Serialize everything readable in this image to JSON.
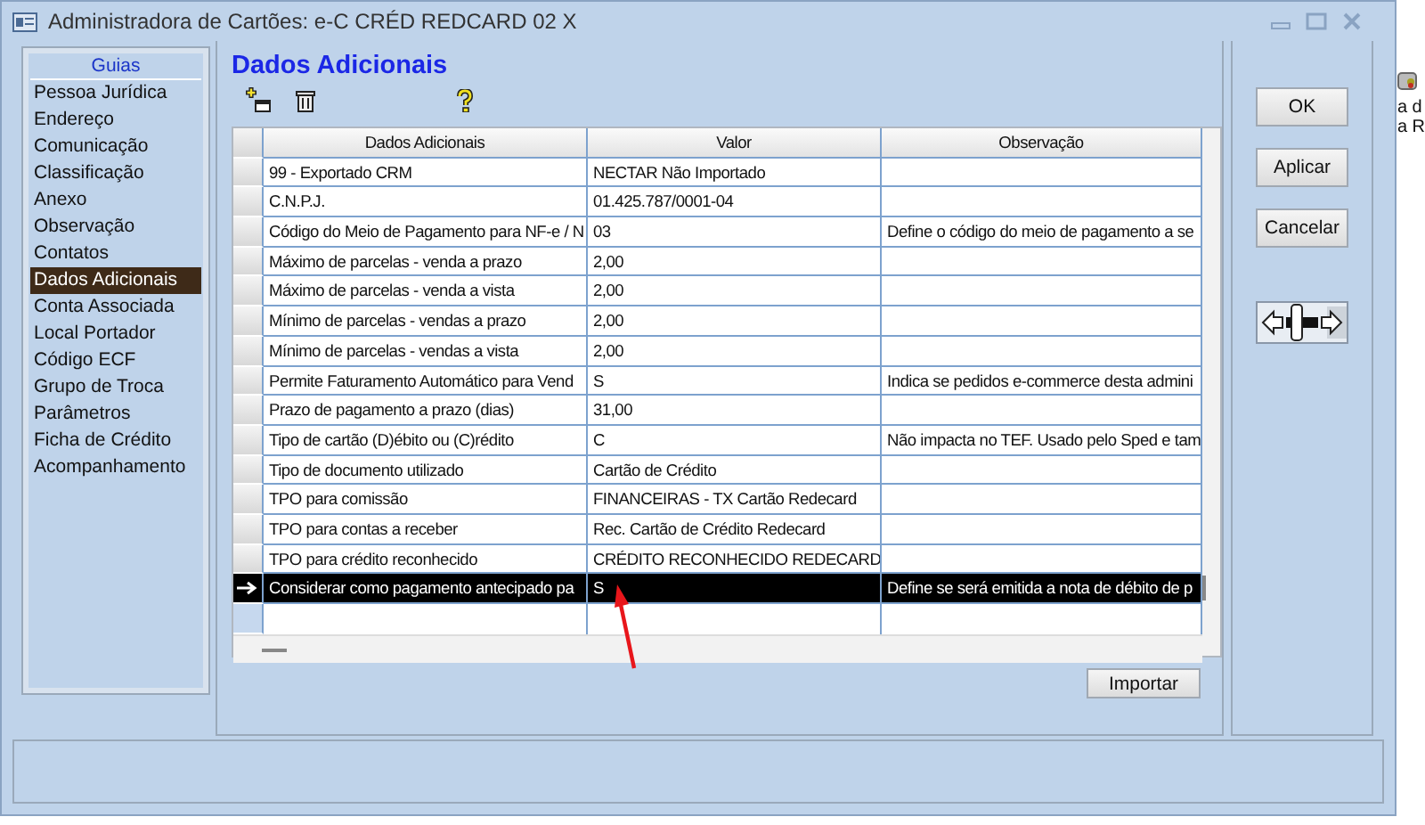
{
  "window": {
    "title": "Administradora de Cartões: e-C CRÉD REDCARD 02 X"
  },
  "sidebar": {
    "header": "Guias",
    "items": [
      {
        "label": "Pessoa Jurídica",
        "selected": false
      },
      {
        "label": "Endereço",
        "selected": false
      },
      {
        "label": "Comunicação",
        "selected": false
      },
      {
        "label": "Classificação",
        "selected": false
      },
      {
        "label": "Anexo",
        "selected": false
      },
      {
        "label": "Observação",
        "selected": false
      },
      {
        "label": "Contatos",
        "selected": false
      },
      {
        "label": "Dados Adicionais",
        "selected": true
      },
      {
        "label": "Conta Associada",
        "selected": false
      },
      {
        "label": "Local Portador",
        "selected": false
      },
      {
        "label": "Código ECF",
        "selected": false
      },
      {
        "label": "Grupo de Troca",
        "selected": false
      },
      {
        "label": "Parâmetros",
        "selected": false
      },
      {
        "label": "Ficha de Crédito",
        "selected": false
      },
      {
        "label": "Acompanhamento",
        "selected": false
      }
    ]
  },
  "panel": {
    "title": "Dados Adicionais"
  },
  "table": {
    "columns": [
      "Dados Adicionais",
      "Valor",
      "Observação"
    ],
    "rows": [
      {
        "cells": [
          "99 - Exportado CRM",
          "NECTAR Não Importado",
          ""
        ],
        "selected": false
      },
      {
        "cells": [
          "C.N.P.J.",
          "01.425.787/0001-04",
          ""
        ],
        "selected": false
      },
      {
        "cells": [
          "Código do Meio de Pagamento para NF-e / N",
          "03",
          "Define o código do meio de pagamento a se"
        ],
        "selected": false
      },
      {
        "cells": [
          "Máximo de parcelas - venda a prazo",
          "2,00",
          ""
        ],
        "selected": false
      },
      {
        "cells": [
          "Máximo de parcelas - venda a vista",
          "2,00",
          ""
        ],
        "selected": false
      },
      {
        "cells": [
          "Mínimo de parcelas - vendas a prazo",
          "2,00",
          ""
        ],
        "selected": false
      },
      {
        "cells": [
          "Mínimo de parcelas - vendas a vista",
          "2,00",
          ""
        ],
        "selected": false
      },
      {
        "cells": [
          "Permite Faturamento Automático para Vend",
          "S",
          "Indica se pedidos e-commerce desta admini"
        ],
        "selected": false
      },
      {
        "cells": [
          "Prazo de pagamento a prazo (dias)",
          "31,00",
          ""
        ],
        "selected": false
      },
      {
        "cells": [
          "Tipo de cartão (D)ébito ou (C)rédito",
          "C",
          "Não impacta no TEF. Usado pelo Sped e tam"
        ],
        "selected": false
      },
      {
        "cells": [
          "Tipo de documento utilizado",
          "Cartão de Crédito",
          ""
        ],
        "selected": false
      },
      {
        "cells": [
          "TPO para comissão",
          "FINANCEIRAS - TX Cartão Redecard",
          ""
        ],
        "selected": false
      },
      {
        "cells": [
          "TPO para contas a receber",
          "Rec. Cartão de Crédito Redecard",
          ""
        ],
        "selected": false
      },
      {
        "cells": [
          "TPO para crédito reconhecido",
          "CRÉDITO RECONHECIDO REDECARD",
          ""
        ],
        "selected": false
      },
      {
        "cells": [
          "Considerar como pagamento antecipado pa",
          "S",
          "Define se será emitida a nota de débito de p"
        ],
        "selected": true
      }
    ]
  },
  "import_button": "Importar",
  "buttons": [
    "OK",
    "Aplicar",
    "Cancelar"
  ],
  "background_window": {
    "lines": [
      "a d",
      "a R"
    ]
  }
}
